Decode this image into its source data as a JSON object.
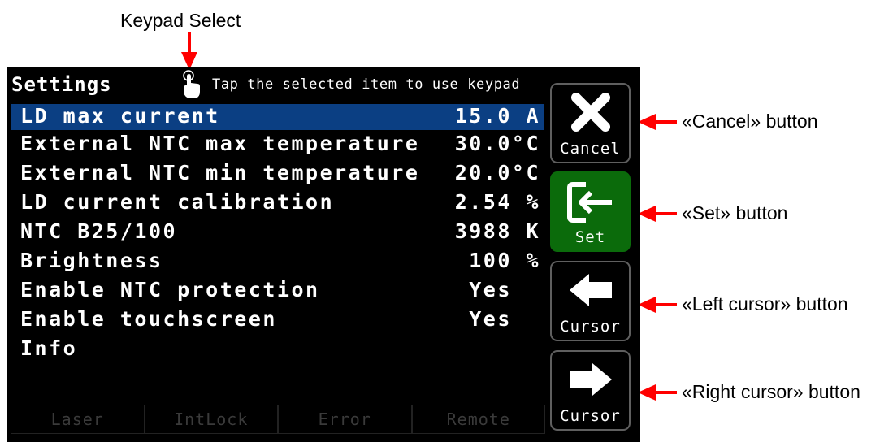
{
  "callouts": {
    "keypad_select": "Keypad Select",
    "cancel": "«Cancel» button",
    "set": "«Set» button",
    "left_cursor": "«Left cursor» button",
    "right_cursor": "«Right cursor» button"
  },
  "screen": {
    "title": "Settings",
    "hint": "Tap the selected item to use keypad",
    "hint_icon": "touch-hand-icon",
    "rows": [
      {
        "label": "LD max current",
        "value": "15.0 A",
        "selected": true
      },
      {
        "label": "External NTC max temperature",
        "value": "30.0°C",
        "selected": false
      },
      {
        "label": "External NTC min temperature",
        "value": "20.0°C",
        "selected": false
      },
      {
        "label": "LD current calibration",
        "value": "2.54 %",
        "selected": false
      },
      {
        "label": "NTC B25/100",
        "value": "3988 K",
        "selected": false
      },
      {
        "label": "Brightness",
        "value": "100 %",
        "selected": false
      },
      {
        "label": "Enable NTC protection",
        "value": "Yes  ",
        "selected": false
      },
      {
        "label": "Enable touchscreen",
        "value": "Yes  ",
        "selected": false
      },
      {
        "label": "Info",
        "value": "",
        "selected": false
      }
    ],
    "status": [
      "Laser",
      "IntLock",
      "Error",
      "Remote"
    ]
  },
  "buttons": {
    "cancel": {
      "label": "Cancel",
      "icon": "close-icon"
    },
    "set": {
      "label": "Set",
      "icon": "enter-icon"
    },
    "left": {
      "label": "Cursor",
      "icon": "arrow-left-icon"
    },
    "right": {
      "label": "Cursor",
      "icon": "arrow-right-icon"
    }
  },
  "colors": {
    "selected_row": "#0b3f83",
    "set_button": "#0b6b0b",
    "callout_arrow": "#ff0000",
    "status_text": "#3a3a3a"
  }
}
